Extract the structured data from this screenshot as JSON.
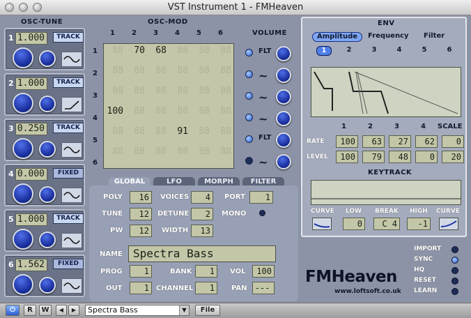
{
  "window": {
    "title": "VST Instrument 1 - FMHeaven"
  },
  "osc_tune": {
    "title": "OSC-TUNE",
    "oscillators": [
      {
        "num": "1",
        "value": "1.000",
        "mode": "TRACK",
        "wave": "sine"
      },
      {
        "num": "2",
        "value": "1.000",
        "mode": "TRACK",
        "wave": "ramp"
      },
      {
        "num": "3",
        "value": "0.250",
        "mode": "TRACK",
        "wave": "sine"
      },
      {
        "num": "4",
        "value": "0.000",
        "mode": "FIXED",
        "wave": "sine"
      },
      {
        "num": "5",
        "value": "1.000",
        "mode": "TRACK",
        "wave": "sine"
      },
      {
        "num": "6",
        "value": "1.562",
        "mode": "FIXED",
        "wave": "sine"
      }
    ]
  },
  "osc_mod": {
    "title": "OSC-MOD",
    "col_headers": [
      "1",
      "2",
      "3",
      "4",
      "5",
      "6"
    ],
    "row_headers": [
      "1",
      "2",
      "3",
      "4",
      "5",
      "6"
    ],
    "cells": [
      [
        "",
        "70",
        "68",
        "",
        "",
        ""
      ],
      [
        "",
        "",
        "",
        "",
        "",
        ""
      ],
      [
        "",
        "",
        "",
        "",
        "",
        ""
      ],
      [
        "100",
        "",
        "",
        "",
        "",
        ""
      ],
      [
        "",
        "",
        "",
        "91",
        "",
        ""
      ],
      [
        "",
        "",
        "",
        "",
        "",
        ""
      ]
    ],
    "ghost": "88"
  },
  "volume": {
    "title": "VOLUME",
    "rows": [
      {
        "mode": "FLT",
        "led": "on"
      },
      {
        "mode": "~",
        "led": "on"
      },
      {
        "mode": "~",
        "led": "on"
      },
      {
        "mode": "~",
        "led": "on"
      },
      {
        "mode": "FLT",
        "led": "on"
      },
      {
        "mode": "~",
        "led": "off"
      }
    ]
  },
  "env": {
    "title": "ENV",
    "tabs": [
      "Amplitude",
      "Frequency",
      "Filter"
    ],
    "selected_tab": "Amplitude",
    "numbers": [
      "1",
      "2",
      "3",
      "4",
      "5",
      "6"
    ],
    "selected_number": "1",
    "col_headers": [
      "1",
      "2",
      "3",
      "4",
      "SCALE"
    ],
    "rate_label": "RATE",
    "level_label": "LEVEL",
    "rate": [
      "100",
      "63",
      "27",
      "62",
      "0"
    ],
    "level": [
      "100",
      "79",
      "48",
      "0",
      "20"
    ],
    "keytrack_title": "KEYTRACK",
    "keytrack": {
      "curve_l": "CURVE",
      "low": "LOW",
      "break": "BREAK",
      "high": "HIGH",
      "curve_r": "CURVE",
      "low_val": "0",
      "break_val": "C 4",
      "high_val": "-1"
    }
  },
  "global": {
    "tabs": [
      "GLOBAL",
      "LFO",
      "MORPH",
      "FILTER"
    ],
    "selected_tab": "GLOBAL",
    "poly": {
      "label": "POLY",
      "value": "16"
    },
    "tune": {
      "label": "TUNE",
      "value": "12"
    },
    "pw": {
      "label": "PW",
      "value": "12"
    },
    "voices": {
      "label": "VOICES",
      "value": "4"
    },
    "detune": {
      "label": "DETUNE",
      "value": "2"
    },
    "width": {
      "label": "WIDTH",
      "value": "13"
    },
    "port": {
      "label": "PORT",
      "value": "1"
    },
    "mono": {
      "label": "MONO"
    },
    "name": {
      "label": "NAME",
      "value": "Spectra Bass"
    },
    "prog": {
      "label": "PROG",
      "value": "1"
    },
    "bank": {
      "label": "BANK",
      "value": "1"
    },
    "vol": {
      "label": "VOL",
      "value": "100"
    },
    "out": {
      "label": "OUT",
      "value": "1"
    },
    "channel": {
      "label": "CHANNEL",
      "value": "1"
    },
    "pan": {
      "label": "PAN",
      "value": "---"
    }
  },
  "brand": {
    "name": "FMHeaven",
    "url": "www.loftsoft.co.uk"
  },
  "side_buttons": [
    {
      "label": "IMPORT",
      "led": "off"
    },
    {
      "label": "SYNC",
      "led": "on"
    },
    {
      "label": "HQ",
      "led": "off"
    },
    {
      "label": "RESET",
      "led": "off"
    },
    {
      "label": "LEARN",
      "led": "off"
    }
  ],
  "bottom": {
    "power": "⏻",
    "r": "R",
    "w": "W",
    "prev": "◀",
    "next": "▶",
    "preset": "Spectra Bass",
    "file": "File"
  },
  "colors": {
    "panel": "#8c93a6",
    "lcd": "#c3c7a8",
    "knob": "#2a48cc",
    "accent": "#1d33a3"
  }
}
